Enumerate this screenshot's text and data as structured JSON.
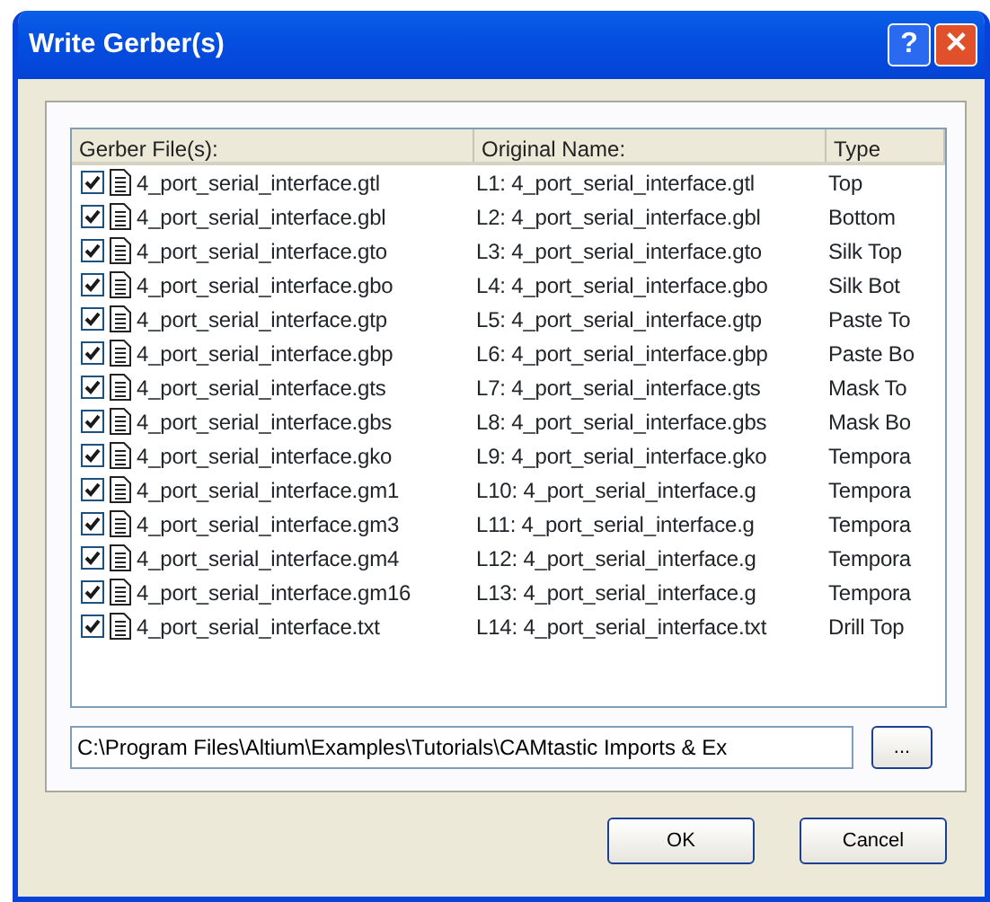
{
  "window": {
    "title": "Write Gerber(s)",
    "buttons": [
      {
        "kind": "help",
        "label": "?"
      },
      {
        "kind": "close",
        "label": "✕"
      }
    ]
  },
  "table": {
    "columns": [
      "Gerber File(s):",
      "Original Name:",
      "Type"
    ],
    "rows": [
      {
        "checked": true,
        "file": "4_port_serial_interface.gtl",
        "original": "L1: 4_port_serial_interface.gtl",
        "type": "Top"
      },
      {
        "checked": true,
        "file": "4_port_serial_interface.gbl",
        "original": "L2: 4_port_serial_interface.gbl",
        "type": "Bottom"
      },
      {
        "checked": true,
        "file": "4_port_serial_interface.gto",
        "original": "L3: 4_port_serial_interface.gto",
        "type": "Silk Top"
      },
      {
        "checked": true,
        "file": "4_port_serial_interface.gbo",
        "original": "L4: 4_port_serial_interface.gbo",
        "type": "Silk Bot"
      },
      {
        "checked": true,
        "file": "4_port_serial_interface.gtp",
        "original": "L5: 4_port_serial_interface.gtp",
        "type": "Paste To"
      },
      {
        "checked": true,
        "file": "4_port_serial_interface.gbp",
        "original": "L6: 4_port_serial_interface.gbp",
        "type": "Paste Bo"
      },
      {
        "checked": true,
        "file": "4_port_serial_interface.gts",
        "original": "L7: 4_port_serial_interface.gts",
        "type": "Mask To"
      },
      {
        "checked": true,
        "file": "4_port_serial_interface.gbs",
        "original": "L8: 4_port_serial_interface.gbs",
        "type": "Mask Bo"
      },
      {
        "checked": true,
        "file": "4_port_serial_interface.gko",
        "original": "L9: 4_port_serial_interface.gko",
        "type": "Tempora"
      },
      {
        "checked": true,
        "file": "4_port_serial_interface.gm1",
        "original": "L10: 4_port_serial_interface.g",
        "type": "Tempora"
      },
      {
        "checked": true,
        "file": "4_port_serial_interface.gm3",
        "original": "L11: 4_port_serial_interface.g",
        "type": "Tempora"
      },
      {
        "checked": true,
        "file": "4_port_serial_interface.gm4",
        "original": "L12: 4_port_serial_interface.g",
        "type": "Tempora"
      },
      {
        "checked": true,
        "file": "4_port_serial_interface.gm16",
        "original": "L13: 4_port_serial_interface.g",
        "type": "Tempora"
      },
      {
        "checked": true,
        "file": "4_port_serial_interface.txt",
        "original": "L14: 4_port_serial_interface.txt",
        "type": "Drill Top"
      }
    ]
  },
  "path": {
    "value": "C:\\Program Files\\Altium\\Examples\\Tutorials\\CAMtastic Imports & Ex",
    "browse": "..."
  },
  "buttons": [
    "OK",
    "Cancel"
  ]
}
